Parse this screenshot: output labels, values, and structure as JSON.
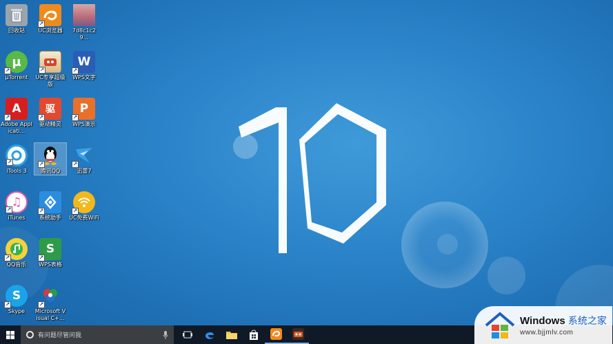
{
  "desktop": {
    "wallpaper_numeral": "10",
    "icons": [
      {
        "label": "回收站",
        "icon": "recycle-bin-icon",
        "color": "#9aa4ad"
      },
      {
        "label": "UC浏览器",
        "icon": "uc-browser-icon",
        "color": "#f08a1c"
      },
      {
        "label": "7d8c1c29...",
        "icon": "image-file-icon",
        "color": "#c98a90"
      },
      {
        "label": "μTorrent",
        "icon": "utorrent-icon",
        "color": "#57b947"
      },
      {
        "label": "UC专享超级版",
        "icon": "uc-super-icon",
        "color": "#e7d6b2"
      },
      {
        "label": "WPS文字",
        "icon": "wps-writer-icon",
        "color": "#2a5db6"
      },
      {
        "label": "Adobe Applicati...",
        "icon": "adobe-icon",
        "color": "#d61e1e"
      },
      {
        "label": "驱动精灵",
        "icon": "driver-genius-icon",
        "color": "#e2492f"
      },
      {
        "label": "WPS演示",
        "icon": "wps-presentation-icon",
        "color": "#e8702a"
      },
      {
        "label": "iTools 3",
        "icon": "itools-icon",
        "color": "#2aa0e0"
      },
      {
        "label": "腾讯QQ",
        "icon": "qq-icon",
        "color": "#222222"
      },
      {
        "label": "迅雷7",
        "icon": "xunlei-icon",
        "color": "#3aa0e6"
      },
      {
        "label": "iTunes",
        "icon": "itunes-icon",
        "color": "#e85aa8"
      },
      {
        "label": "系统助手",
        "icon": "system-helper-icon",
        "color": "#2b8de0"
      },
      {
        "label": "UC免费WiFi",
        "icon": "uc-wifi-icon",
        "color": "#f3b81c"
      },
      {
        "label": "QQ音乐",
        "icon": "qq-music-icon",
        "color": "#37b24d"
      },
      {
        "label": "WPS表格",
        "icon": "wps-spreadsheet-icon",
        "color": "#2e9b48"
      },
      {
        "label": "Skype",
        "icon": "skype-icon",
        "color": "#1aa3e8"
      },
      {
        "label": "Microsoft Visual C+...",
        "icon": "visual-cpp-icon",
        "color": "#d63a3a"
      }
    ]
  },
  "taskbar": {
    "search_placeholder": "有问题尽管问我",
    "apps": [
      {
        "name": "task-view-icon"
      },
      {
        "name": "edge-icon",
        "color": "#2d8fe6"
      },
      {
        "name": "file-explorer-icon",
        "color": "#f2c04a"
      },
      {
        "name": "store-icon",
        "color": "#ffffff"
      },
      {
        "name": "uc-browser-taskbar-icon",
        "color": "#f08a1c"
      },
      {
        "name": "uc-super-taskbar-icon",
        "color": "#e35a2a"
      }
    ]
  },
  "watermark": {
    "brand": "Windows",
    "site_name": "系统之家",
    "url": "www.bjjmlv.com"
  }
}
